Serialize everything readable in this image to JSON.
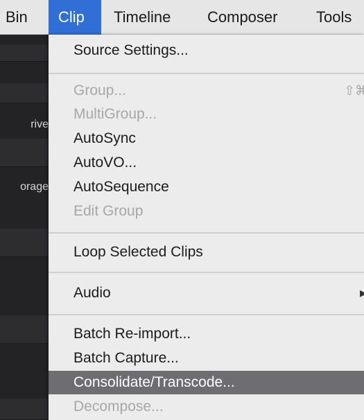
{
  "menubar": {
    "items": [
      {
        "label": "Bin"
      },
      {
        "label": "Clip",
        "active": true
      },
      {
        "label": "Timeline"
      },
      {
        "label": "Composer"
      },
      {
        "label": "Tools"
      }
    ]
  },
  "background_panel": {
    "labels": [
      "rive",
      "orage"
    ]
  },
  "clip_menu": {
    "items": [
      {
        "label": "Source Settings...",
        "enabled": true
      },
      {
        "label": "Group...",
        "enabled": false,
        "shortcut": "⇧⌘"
      },
      {
        "label": "MultiGroup...",
        "enabled": false
      },
      {
        "label": "AutoSync",
        "enabled": true
      },
      {
        "label": "AutoVO...",
        "enabled": true
      },
      {
        "label": "AutoSequence",
        "enabled": true
      },
      {
        "label": "Edit Group",
        "enabled": false
      },
      {
        "label": "Loop Selected Clips",
        "enabled": true
      },
      {
        "label": "Audio",
        "enabled": true,
        "submenu": true
      },
      {
        "label": "Batch Re-import...",
        "enabled": true
      },
      {
        "label": "Batch Capture...",
        "enabled": true
      },
      {
        "label": "Consolidate/Transcode...",
        "enabled": true,
        "highlighted": true
      },
      {
        "label": "Decompose...",
        "enabled": false
      }
    ]
  },
  "colors": {
    "menubar_bg": "#e6e6e6",
    "active_menu_bg": "#2f6fd6",
    "menu_bg": "#ececec",
    "highlight_bg": "#6d6d72",
    "disabled_text": "#a7a7a7",
    "app_bg": "#232325"
  }
}
